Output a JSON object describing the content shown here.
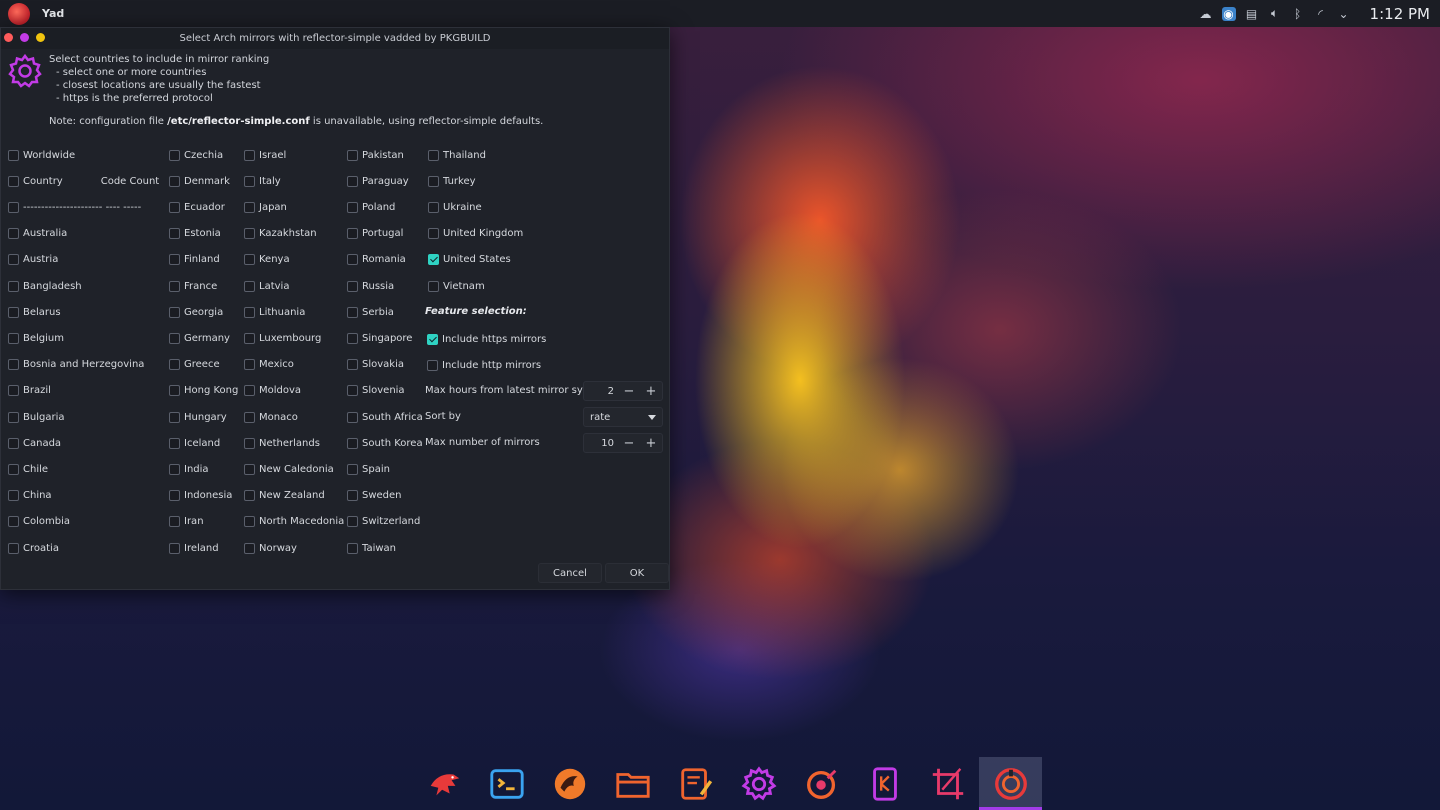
{
  "panel": {
    "app_name": "Yad",
    "clock": "1:12 PM",
    "tray_icons": [
      "steam-icon",
      "eye-icon",
      "clipboard-icon",
      "volume-icon",
      "bluetooth-icon",
      "wifi-icon",
      "chevron-down-icon"
    ]
  },
  "dialog": {
    "title": "Select Arch mirrors with reflector-simple vadded by PKGBUILD",
    "instructions": [
      "Select countries to include in mirror ranking",
      "- select one or more countries",
      "- closest locations are usually the fastest",
      "- https is the preferred protocol"
    ],
    "note_prefix": "Note: configuration file ",
    "note_file": "/etc/reflector-simple.conf",
    "note_suffix": " is unavailable, using reflector-simple defaults.",
    "col1": [
      {
        "label": "Worldwide",
        "checked": false
      },
      {
        "label": "Country",
        "extra": "Code Count",
        "checked": false
      },
      {
        "label": "---------------------- ---- -----",
        "checked": false
      },
      {
        "label": "Australia",
        "checked": false
      },
      {
        "label": "Austria",
        "checked": false
      },
      {
        "label": "Bangladesh",
        "checked": false
      },
      {
        "label": "Belarus",
        "checked": false
      },
      {
        "label": "Belgium",
        "checked": false
      },
      {
        "label": "Bosnia and Herzegovina",
        "checked": false
      },
      {
        "label": "Brazil",
        "checked": false
      },
      {
        "label": "Bulgaria",
        "checked": false
      },
      {
        "label": "Canada",
        "checked": false
      },
      {
        "label": "Chile",
        "checked": false
      },
      {
        "label": "China",
        "checked": false
      },
      {
        "label": "Colombia",
        "checked": false
      },
      {
        "label": "Croatia",
        "checked": false
      }
    ],
    "col2": [
      {
        "label": "Czechia",
        "checked": false
      },
      {
        "label": "Denmark",
        "checked": false
      },
      {
        "label": "Ecuador",
        "checked": false
      },
      {
        "label": "Estonia",
        "checked": false
      },
      {
        "label": "Finland",
        "checked": false
      },
      {
        "label": "France",
        "checked": false
      },
      {
        "label": "Georgia",
        "checked": false
      },
      {
        "label": "Germany",
        "checked": false
      },
      {
        "label": "Greece",
        "checked": false
      },
      {
        "label": "Hong Kong",
        "checked": false
      },
      {
        "label": "Hungary",
        "checked": false
      },
      {
        "label": "Iceland",
        "checked": false
      },
      {
        "label": "India",
        "checked": false
      },
      {
        "label": "Indonesia",
        "checked": false
      },
      {
        "label": "Iran",
        "checked": false
      },
      {
        "label": "Ireland",
        "checked": false
      }
    ],
    "col3": [
      {
        "label": "Israel",
        "checked": false
      },
      {
        "label": "Italy",
        "checked": false
      },
      {
        "label": "Japan",
        "checked": false
      },
      {
        "label": "Kazakhstan",
        "checked": false
      },
      {
        "label": "Kenya",
        "checked": false
      },
      {
        "label": "Latvia",
        "checked": false
      },
      {
        "label": "Lithuania",
        "checked": false
      },
      {
        "label": "Luxembourg",
        "checked": false
      },
      {
        "label": "Mexico",
        "checked": false
      },
      {
        "label": "Moldova",
        "checked": false
      },
      {
        "label": "Monaco",
        "checked": false
      },
      {
        "label": "Netherlands",
        "checked": false
      },
      {
        "label": "New Caledonia",
        "checked": false
      },
      {
        "label": "New Zealand",
        "checked": false
      },
      {
        "label": "North Macedonia",
        "checked": false
      },
      {
        "label": "Norway",
        "checked": false
      }
    ],
    "col4": [
      {
        "label": "Pakistan",
        "checked": false
      },
      {
        "label": "Paraguay",
        "checked": false
      },
      {
        "label": "Poland",
        "checked": false
      },
      {
        "label": "Portugal",
        "checked": false
      },
      {
        "label": "Romania",
        "checked": false
      },
      {
        "label": "Russia",
        "checked": false
      },
      {
        "label": "Serbia",
        "checked": false
      },
      {
        "label": "Singapore",
        "checked": false
      },
      {
        "label": "Slovakia",
        "checked": false
      },
      {
        "label": "Slovenia",
        "checked": false
      },
      {
        "label": "South Africa",
        "checked": false
      },
      {
        "label": "South Korea",
        "checked": false
      },
      {
        "label": "Spain",
        "checked": false
      },
      {
        "label": "Sweden",
        "checked": false
      },
      {
        "label": "Switzerland",
        "checked": false
      },
      {
        "label": "Taiwan",
        "checked": false
      }
    ],
    "col5": [
      {
        "label": "Thailand",
        "checked": false
      },
      {
        "label": "Turkey",
        "checked": false
      },
      {
        "label": "Ukraine",
        "checked": false
      },
      {
        "label": "United Kingdom",
        "checked": false
      },
      {
        "label": "United States",
        "checked": true
      },
      {
        "label": "Vietnam",
        "checked": false
      }
    ],
    "features": {
      "title": "Feature selection:",
      "https": {
        "label": "Include https mirrors",
        "checked": true
      },
      "http": {
        "label": "Include http mirrors",
        "checked": false
      },
      "max_hours_label": "Max hours from latest mirror sync",
      "max_hours_value": "2",
      "sort_label": "Sort by",
      "sort_value": "rate",
      "max_mirrors_label": "Max number of mirrors",
      "max_mirrors_value": "10",
      "minus": "−",
      "plus": "+"
    },
    "cancel_label": "Cancel",
    "ok_label": "OK"
  },
  "dock": [
    "garuda-eagle-icon",
    "terminal-icon",
    "firedragon-browser-icon",
    "folder-icon",
    "text-editor-icon",
    "settings-gear-icon",
    "garuda-assistant-icon",
    "kvantum-icon",
    "screenshot-crop-icon",
    "garuda-welcome-icon"
  ],
  "colors": {
    "accent": "#2fd3c3",
    "dock_active": "#a23ce8"
  }
}
